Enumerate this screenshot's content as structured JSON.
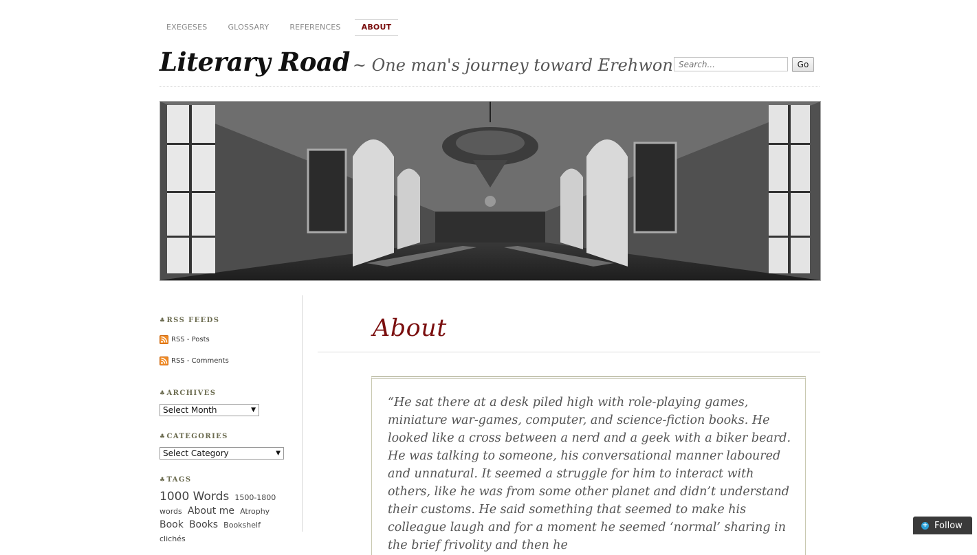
{
  "nav": {
    "items": [
      {
        "label": "EXEGESES"
      },
      {
        "label": "GLOSSARY"
      },
      {
        "label": "REFERENCES"
      },
      {
        "label": "ABOUT"
      }
    ],
    "active": "ABOUT"
  },
  "header": {
    "site_name": "Literary Road",
    "tagline": "~ One man's journey toward Erehwon!",
    "search_placeholder": "Search...",
    "search_button": "Go"
  },
  "sidebar": {
    "rss": {
      "title": "RSS FEEDS",
      "posts": "RSS - Posts",
      "comments": "RSS - Comments"
    },
    "archives": {
      "title": "ARCHIVES",
      "selected": "Select Month"
    },
    "categories": {
      "title": "CATEGORIES",
      "selected": "Select Category"
    },
    "tags": {
      "title": "TAGS",
      "items": [
        {
          "label": "1000 Words",
          "size": 17
        },
        {
          "label": "1500-1800 words",
          "size": 11
        },
        {
          "label": "About me",
          "size": 14
        },
        {
          "label": "Atrophy",
          "size": 11
        },
        {
          "label": "Book",
          "size": 14
        },
        {
          "label": "Books",
          "size": 14
        },
        {
          "label": "Bookshelf",
          "size": 11
        },
        {
          "label": "clichés",
          "size": 11
        }
      ]
    }
  },
  "main": {
    "title": "About",
    "quote": "“He sat there at a desk piled high with role-playing games, miniature war-games, computer, and science-fiction books. He looked like a cross between a nerd and a geek with a biker beard. He was talking to someone, his conversational manner laboured and unnatural. It seemed a struggle for him to interact with others, like he was from some other planet and didn’t understand their customs. He said something that seemed to make his colleague laugh and for a moment he seemed ‘normal’ sharing in the brief frivolity and then he"
  },
  "follow": {
    "label": "Follow",
    "icon": "plus-icon"
  },
  "colors": {
    "accent": "#7a0e0e",
    "widget_title": "#6b6b4f",
    "rss": "#f08a24",
    "follow_bg": "#3a3a3a"
  }
}
